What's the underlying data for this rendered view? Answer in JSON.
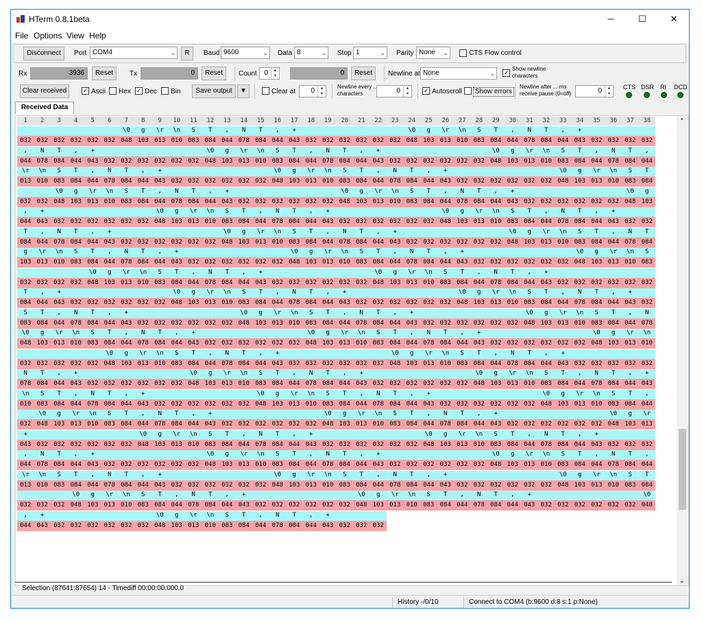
{
  "window": {
    "title": "HTerm 0.8.1beta",
    "controls": [
      "─",
      "☐",
      "✕"
    ]
  },
  "menu": [
    "File",
    "Options",
    "View",
    "Help"
  ],
  "connection": {
    "disconnect_label": "Disconnect",
    "port_label": "Port",
    "port_value": "COM4",
    "refresh_label": "R",
    "baud_label": "Baud",
    "baud_value": "9600",
    "data_label": "Data",
    "data_value": "8",
    "stop_label": "Stop",
    "stop_value": "1",
    "parity_label": "Parity",
    "parity_value": "None",
    "cts_label": "CTS Flow control"
  },
  "counters": {
    "rx_label": "Rx",
    "rx_value": "3936",
    "rx_reset": "Reset",
    "tx_label": "Tx",
    "tx_value": "0",
    "tx_reset": "Reset",
    "count_label": "Count",
    "count_value": "0",
    "count_field": "0",
    "count_reset": "Reset",
    "newline_label": "Newline at",
    "newline_value": "None",
    "show_newline_label": "Show newline characters"
  },
  "options": {
    "clear_received": "Clear received",
    "ascii": "Ascii",
    "hex": "Hex",
    "dec": "Dec",
    "bin": "Bin",
    "save_output": "Save output",
    "clear_at": "Clear at",
    "clear_at_value": "0",
    "newline_every_label": "Newline every ... characters",
    "newline_every_value": "0",
    "autoscroll": "Autoscroll",
    "show_errors": "Show errors",
    "newline_after_label": "Newline after ... ms receive pause (0=off)",
    "newline_after_value": "0",
    "signals": [
      "CTS",
      "DSR",
      "RI",
      "DCD"
    ]
  },
  "tab_label": "Received Data",
  "columns": [
    "1",
    "2",
    "3",
    "4",
    "5",
    "6",
    "7",
    "8",
    "9",
    "10",
    "11",
    "12",
    "13",
    "14",
    "15",
    "16",
    "17",
    "18",
    "19",
    "20",
    "21",
    "22",
    "23",
    "24",
    "25",
    "26",
    "27",
    "28",
    "29",
    "30",
    "31",
    "32",
    "33",
    "34",
    "35",
    "36",
    "37",
    "38"
  ],
  "pattern_chars": [
    "\\0",
    "g",
    "\\r",
    "\\n",
    "S",
    "T",
    ",",
    "N",
    "T",
    ",",
    "+",
    " ",
    " ",
    " ",
    " ",
    " ",
    " "
  ],
  "pattern_dec": [
    "048",
    "103",
    "013",
    "010",
    "083",
    "084",
    "044",
    "078",
    "084",
    "044",
    "043",
    "032",
    "032",
    "032",
    "032",
    "032",
    "032"
  ],
  "rows": 20,
  "row_offsets": [
    11,
    6,
    2,
    15,
    9,
    5,
    1,
    13,
    8,
    4,
    0,
    12,
    7,
    3,
    16,
    10,
    6,
    2,
    14,
    9
  ],
  "last_row_length": 22,
  "status_line": "Selection (87641:87654) 14  -  Timediff 00:00:00.000.0",
  "history": "History -/0/10",
  "connect_status": "Connect to COM4 (b:9600 d:8 s:1 p:None)",
  "colors": {
    "char_row": "#aaf6f6",
    "dec_row": "#f4a3a8",
    "titlebar": "#ffffff"
  }
}
